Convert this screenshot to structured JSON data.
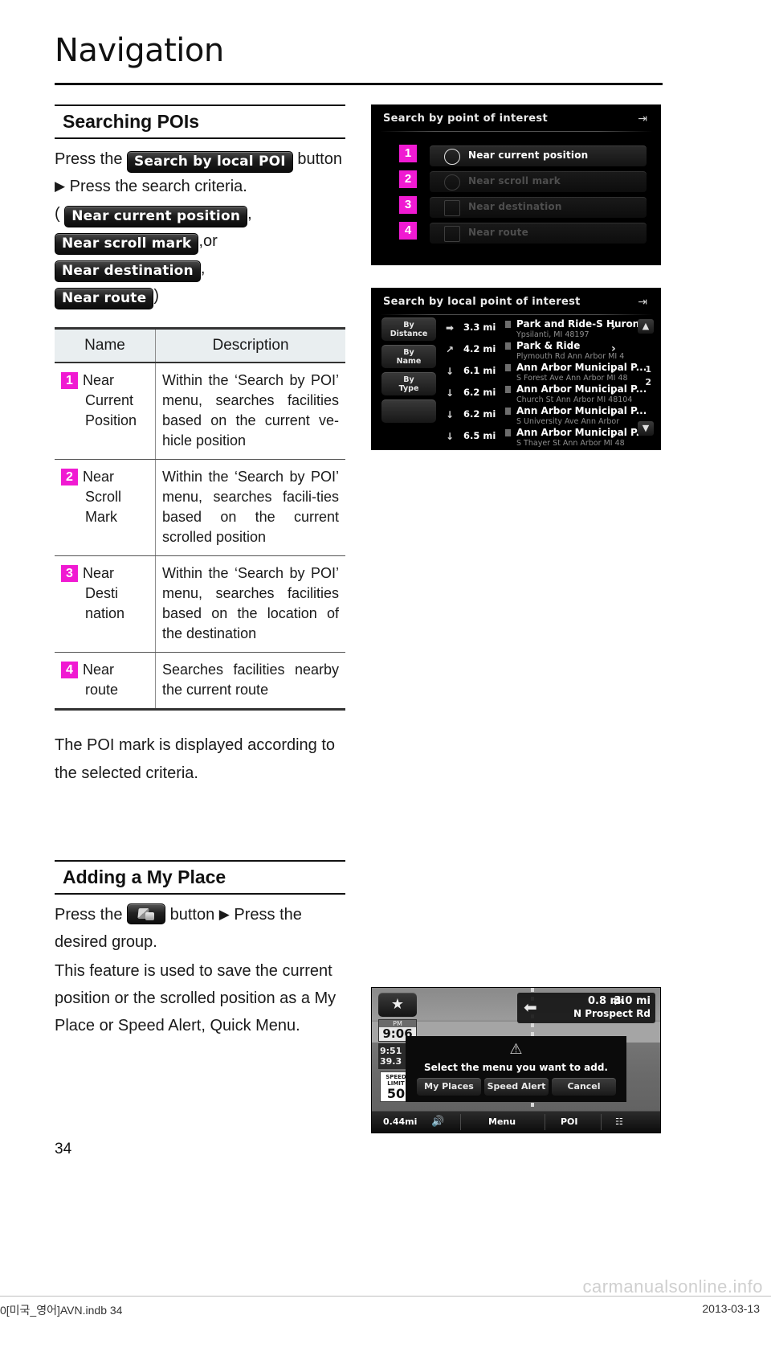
{
  "chapter": {
    "title": "Navigation"
  },
  "sections": {
    "searching": {
      "heading": "Searching POIs",
      "line1_pre": "Press the",
      "key_search_local_poi": "Search by local POI",
      "line1_post": "button",
      "line2": "Press the search criteria.",
      "open_paren": "(",
      "key_near_current_position": "Near current position",
      "comma1": ",",
      "key_near_scroll_mark": "Near scroll mark",
      "or_text": ",or",
      "key_near_destination": "Near destination",
      "comma2": ",",
      "key_near_route": "Near route",
      "close_paren": ")",
      "after_table": "The POI mark is displayed according to the selected criteria."
    },
    "adding": {
      "heading": "Adding a My Place",
      "line1_pre": "Press the",
      "line1_mid": "button",
      "line1_post": "Press the desired group.",
      "para": "This feature is used to save the current position or the scrolled position as a My Place or Speed Alert, Quick Menu."
    }
  },
  "table": {
    "headers": {
      "name": "Name",
      "description": "Description"
    },
    "rows": [
      {
        "badge": "1",
        "name_lines": [
          "Near",
          "Current",
          "Position"
        ],
        "description": "Within the ‘Search by POI’ menu, searches facilities based on the current ve-hicle position"
      },
      {
        "badge": "2",
        "name_lines": [
          "Near",
          "Scroll",
          "Mark"
        ],
        "description": "Within the ‘Search by POI’ menu, searches facili-ties based on the current scrolled position"
      },
      {
        "badge": "3",
        "name_lines": [
          "Near",
          "Desti",
          "nation"
        ],
        "description": "Within the ‘Search by POI’ menu, searches facilities based on the location of the destination"
      },
      {
        "badge": "4",
        "name_lines": [
          "Near",
          "route"
        ],
        "description": "Searches facilities nearby the current route"
      }
    ]
  },
  "screens": {
    "poi_menu": {
      "title": "Search by point of interest",
      "back_icon": "back-arrow-icon",
      "items": [
        {
          "badge": "1",
          "label": "Near current position",
          "enabled": true,
          "icon": "compass-icon"
        },
        {
          "badge": "2",
          "label": "Near scroll mark",
          "enabled": false,
          "icon": "scroll-mark-icon"
        },
        {
          "badge": "3",
          "label": "Near destination",
          "enabled": false,
          "icon": "flag-icon"
        },
        {
          "badge": "4",
          "label": "Near route",
          "enabled": false,
          "icon": "route-icon"
        }
      ]
    },
    "local_poi": {
      "title": "Search by local point of interest",
      "back_icon": "back-arrow-icon",
      "sort_buttons": [
        {
          "l1": "By",
          "l2": "Distance"
        },
        {
          "l1": "By",
          "l2": "Name"
        },
        {
          "l1": "By",
          "l2": "Type"
        },
        {
          "l1": "",
          "l2": ""
        }
      ],
      "up_icon": "▲",
      "down_icon": "▼",
      "page_current": "1",
      "page_total": "2",
      "rows": [
        {
          "arrow": "➡",
          "distance": "3.3 mi",
          "name": "Park and Ride-S Huron...",
          "address": "Ypsilanti, MI 48197",
          "chevron": "›"
        },
        {
          "arrow": "↗",
          "distance": "4.2 mi",
          "name": "Park & Ride",
          "address": "Plymouth Rd  Ann Arbor  MI 4",
          "chevron": "›"
        },
        {
          "arrow": "↓",
          "distance": "6.1 mi",
          "name": "Ann Arbor Municipal P...",
          "address": "S Forest Ave  Ann Arbor  MI 48",
          "chevron": "›"
        },
        {
          "arrow": "↓",
          "distance": "6.2 mi",
          "name": "Ann Arbor Municipal P...",
          "address": "Church St  Ann Arbor  MI 48104",
          "chevron": "›"
        },
        {
          "arrow": "↓",
          "distance": "6.2 mi",
          "name": "Ann Arbor Municipal P...",
          "address": "S University Ave  Ann Arbor",
          "chevron": "›"
        },
        {
          "arrow": "↓",
          "distance": "6.5 mi",
          "name": "Ann Arbor Municipal P...",
          "address": "S Thayer St  Ann Arbor  MI 48",
          "chevron": "›"
        }
      ]
    },
    "map": {
      "star_icon": "★",
      "clock": {
        "ampm": "PM",
        "time": "9:06"
      },
      "eta": {
        "arrival": "9:51",
        "remaining": "39.3"
      },
      "speed_limit": {
        "label": "SPEED LIMIT",
        "value": "50"
      },
      "turn_panel": {
        "next_distance": "0.8 mi",
        "total_distance": "3.0 mi",
        "street": "N Prospect Rd",
        "turn_icon": "turn-left-icon"
      },
      "dialog": {
        "warn_icon": "warning-triangle-icon",
        "message": "Select the menu you want to add.",
        "buttons": [
          "My Places",
          "Speed Alert",
          "Cancel"
        ]
      },
      "bottom_bar": {
        "scale": "0.44mi",
        "speaker_icon": "speaker-icon",
        "menu": "Menu",
        "poi": "POI",
        "quick_icon": "quick-menu-icon"
      }
    }
  },
  "footer": {
    "page_number": "34",
    "left": "0[미국_영어]AVN.indb   34",
    "right": "2013-03-13",
    "watermark": "carmanualsonline.info"
  },
  "colors": {
    "badge_pink": "#f01ad2",
    "ink": "#111111"
  }
}
